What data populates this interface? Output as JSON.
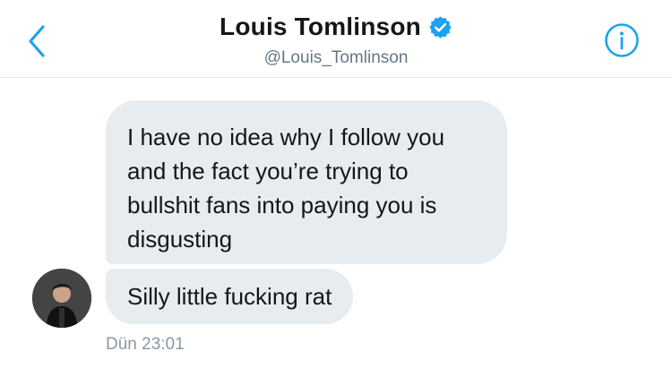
{
  "header": {
    "display_name": "Louis Tomlinson",
    "handle": "@Louis_Tomlinson",
    "back_icon": "chevron-left-icon",
    "verified_icon": "verified-badge-icon",
    "info_icon": "info-icon"
  },
  "messages": [
    {
      "text": "I have no idea why I follow you and the fact you’re trying to bullshit fans into paying you is disgusting"
    },
    {
      "text": "Silly little fucking rat"
    }
  ],
  "timestamp": "Dün 23:01",
  "colors": {
    "accent": "#1da1f2",
    "bubble": "#e6ecf0",
    "text": "#14171a",
    "secondary_text": "#657786"
  }
}
